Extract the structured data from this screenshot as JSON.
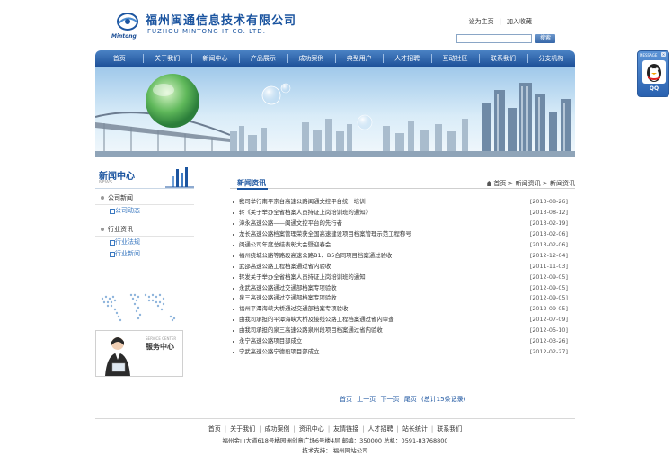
{
  "header": {
    "logo_text": "Mintong",
    "company_cn": "福州闽通信息技术有限公司",
    "company_en": "FUZHOU MINTONG IT CO. LTD.",
    "links": [
      "设为主页",
      "加入收藏"
    ],
    "search_placeholder": "",
    "search_button": "搜索"
  },
  "nav": {
    "items": [
      "首页",
      "关于我们",
      "新闻中心",
      "产品展示",
      "成功案例",
      "典型用户",
      "人才招聘",
      "互动社区",
      "联系我们",
      "分支机构"
    ]
  },
  "sidebar": {
    "title": "新闻中心",
    "title_en": "NEWS",
    "menu": [
      {
        "label": "公司新闻",
        "children": [
          "公司动态"
        ]
      },
      {
        "label": "行业资讯",
        "children": [
          "行业法规",
          "行业新闻"
        ]
      }
    ],
    "service_en": "SERVICE CENTER",
    "service_cn": "服务中心"
  },
  "main": {
    "title": "新闻资讯",
    "breadcrumb": [
      "首页",
      "新闻资讯",
      "新闻资讯"
    ],
    "news": [
      {
        "title": "我司举行南平京台高速公路闽通文控平台统一培训",
        "date": "[2013-08-26]"
      },
      {
        "title": "转《关于举办全省档案人员持证上岗培训班的通知》",
        "date": "[2013-08-12]"
      },
      {
        "title": "漳永高速公路——闽通文控平台的先行者",
        "date": "[2013-02-19]"
      },
      {
        "title": "龙长高速公路档案管理荣获全国高速建设项目档案管理示范工程称号",
        "date": "[2013-02-06]"
      },
      {
        "title": "闽通公司年度总结表彰大会暨迎春会",
        "date": "[2013-02-06]"
      },
      {
        "title": "福州绕城公路等路段高速公路B1、B5合同项目档案通过验收",
        "date": "[2012-12-04]"
      },
      {
        "title": "武邵高速公路工程档案通过省内验收",
        "date": "[2011-11-03]"
      },
      {
        "title": "转发关于举办全省档案人员持证上岗培训班的通知",
        "date": "[2012-09-05]"
      },
      {
        "title": "永武高速公路通过交通部档案专项验收",
        "date": "[2012-09-05]"
      },
      {
        "title": "泉三高速公路通过交通部档案专项验收",
        "date": "[2012-09-05]"
      },
      {
        "title": "福州平潭海峡大桥通过交通部档案专项验收",
        "date": "[2012-09-05]"
      },
      {
        "title": "由我司承担的平潭海峡大桥及接线公路工程档案通过省内审查",
        "date": "[2012-07-09]"
      },
      {
        "title": "由我司承担的泉三高速公路泉州段项目档案通过省内验收",
        "date": "[2012-05-10]"
      },
      {
        "title": "永宁高速公路项目部成立",
        "date": "[2012-03-26]"
      },
      {
        "title": "宁武高速公路宁德段项目部成立",
        "date": "[2012-02-27]"
      }
    ],
    "pager": [
      "首页",
      "上一页",
      "下一页",
      "尾页",
      "(总计15条记录)"
    ]
  },
  "footer": {
    "links": [
      "首页",
      "关于我们",
      "成功案例",
      "资讯中心",
      "友情链接",
      "人才招聘",
      "站长统计",
      "联系我们"
    ],
    "address": "福州金山大道618号橘园洲创意广场6号楼4层  邮编：350000  总机：0591-83768800",
    "tech": "技术支持： 福州网站公司"
  },
  "qq_widget": {
    "header": "MESSAGE",
    "label": "QQ"
  }
}
